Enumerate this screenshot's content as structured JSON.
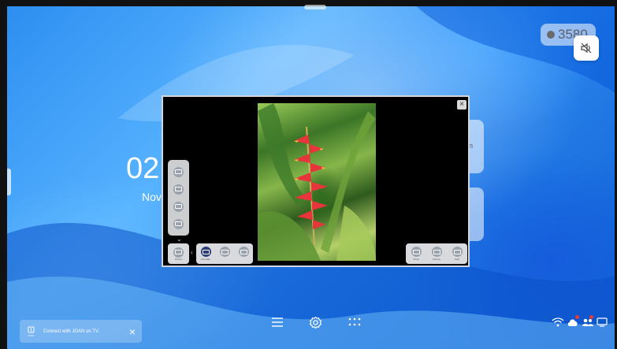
{
  "status": {
    "counter_value": "3580"
  },
  "home": {
    "clock": "02",
    "date": "Nov",
    "card_a_text": "n"
  },
  "window": {
    "close_label": "×",
    "left_strip": [
      {
        "icon": "screen-icon"
      },
      {
        "icon": "screen-icon"
      },
      {
        "icon": "screen-icon"
      },
      {
        "icon": "screen-icon"
      }
    ],
    "left_button": {
      "icon": "cast-icon",
      "label": "Source"
    },
    "left_tools": [
      {
        "icon": "whiteboard-icon",
        "label": "Annotate"
      },
      {
        "icon": "screen-icon",
        "label": ""
      },
      {
        "icon": "screen-icon",
        "label": ""
      }
    ],
    "right_tools": [
      {
        "icon": "display-icon",
        "label": "Show"
      },
      {
        "icon": "volume-icon",
        "label": "Volume"
      },
      {
        "icon": "frame-icon",
        "label": "Split"
      }
    ]
  },
  "toast": {
    "logo_label": "JOAN",
    "message": "Connect with JOAN on TV.",
    "close_label": "×"
  },
  "dock": {
    "items": [
      {
        "icon": "menu-icon"
      },
      {
        "icon": "gear-icon"
      },
      {
        "icon": "apps-grid-icon"
      }
    ]
  },
  "tray": {
    "items": [
      {
        "icon": "wifi-icon"
      },
      {
        "icon": "cloud-icon"
      },
      {
        "icon": "people-icon"
      },
      {
        "icon": "monitor-icon"
      }
    ]
  },
  "colors": {
    "accent": "#2c3b7a",
    "notification": "#e53935"
  }
}
